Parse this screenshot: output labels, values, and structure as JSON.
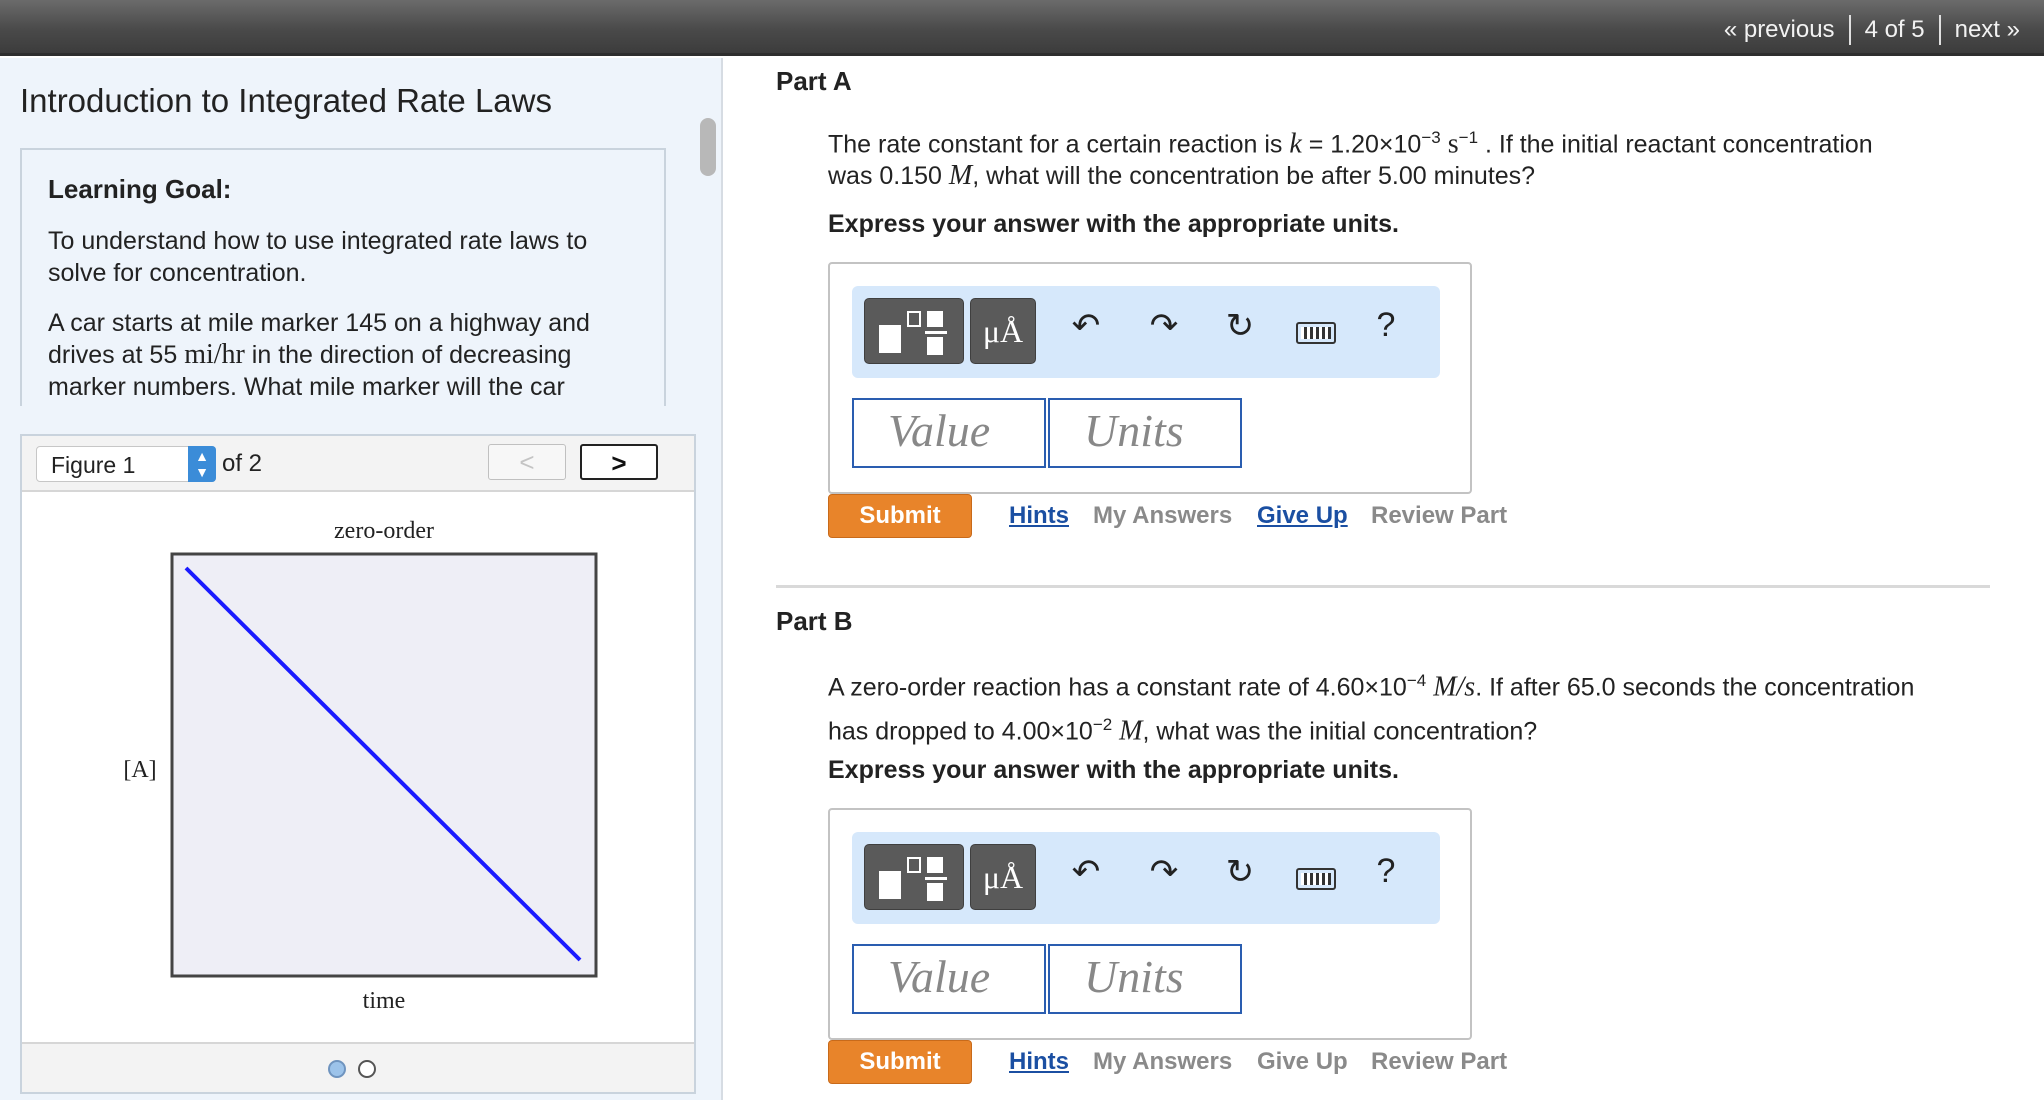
{
  "topnav": {
    "previous": "« previous",
    "position": "4 of 5",
    "next": "next »"
  },
  "left": {
    "title": "Introduction to Integrated Rate Laws",
    "goal_heading": "Learning Goal:",
    "goal_text": "To understand how to use integrated rate laws to solve for concentration.",
    "problem_pre": "A car starts at mile marker 145 on a highway and drives at 55 ",
    "problem_unit": "mi/hr",
    "problem_post": " in the direction of decreasing marker numbers. What mile marker will the car"
  },
  "figure": {
    "select_value": "Figure 1",
    "of_label": "of 2",
    "prev_glyph": "<",
    "next_glyph": ">",
    "title": "zero-order",
    "ylabel": "[A]",
    "xlabel": "time",
    "line_color": "#1a1aff"
  },
  "toolbar": {
    "units_glyph": "μÅ",
    "undo_icon": "undo-icon",
    "redo_icon": "redo-icon",
    "reset_icon": "reset-icon",
    "keyboard_icon": "keyboard-icon",
    "help_glyph": "?"
  },
  "partA": {
    "heading": "Part A",
    "q_line1_pre": "The rate constant for a certain reaction is ",
    "q_k": "k",
    "q_line1_mid": " = 1.20×10",
    "q_exp1": "−3",
    "q_unit_s": " s",
    "q_exp2": "−1",
    "q_line1_post": " . If the initial reactant concentration",
    "q_line2_pre": "was 0.150 ",
    "q_M": "M",
    "q_line2_post": ", what will the concentration be after 5.00 minutes?",
    "express": "Express your answer with the appropriate units.",
    "value_placeholder": "Value",
    "units_placeholder": "Units",
    "submit": "Submit",
    "hints": "Hints",
    "my_answers": "My Answers",
    "give_up": "Give Up",
    "review": "Review Part"
  },
  "partB": {
    "heading": "Part B",
    "q_line1_pre": "A zero-order reaction has a constant rate of 4.60×10",
    "q_exp1": "−4",
    "q_unit": "M/s",
    "q_line1_post": ". If after 65.0 seconds the concentration",
    "q_line2_pre": "has dropped to 4.00×10",
    "q_exp2": "−2",
    "q_M": "M",
    "q_line2_post": ", what was the initial concentration?",
    "express": "Express your answer with the appropriate units.",
    "value_placeholder": "Value",
    "units_placeholder": "Units",
    "submit": "Submit",
    "hints": "Hints",
    "my_answers": "My Answers",
    "give_up": "Give Up",
    "review": "Review Part"
  }
}
